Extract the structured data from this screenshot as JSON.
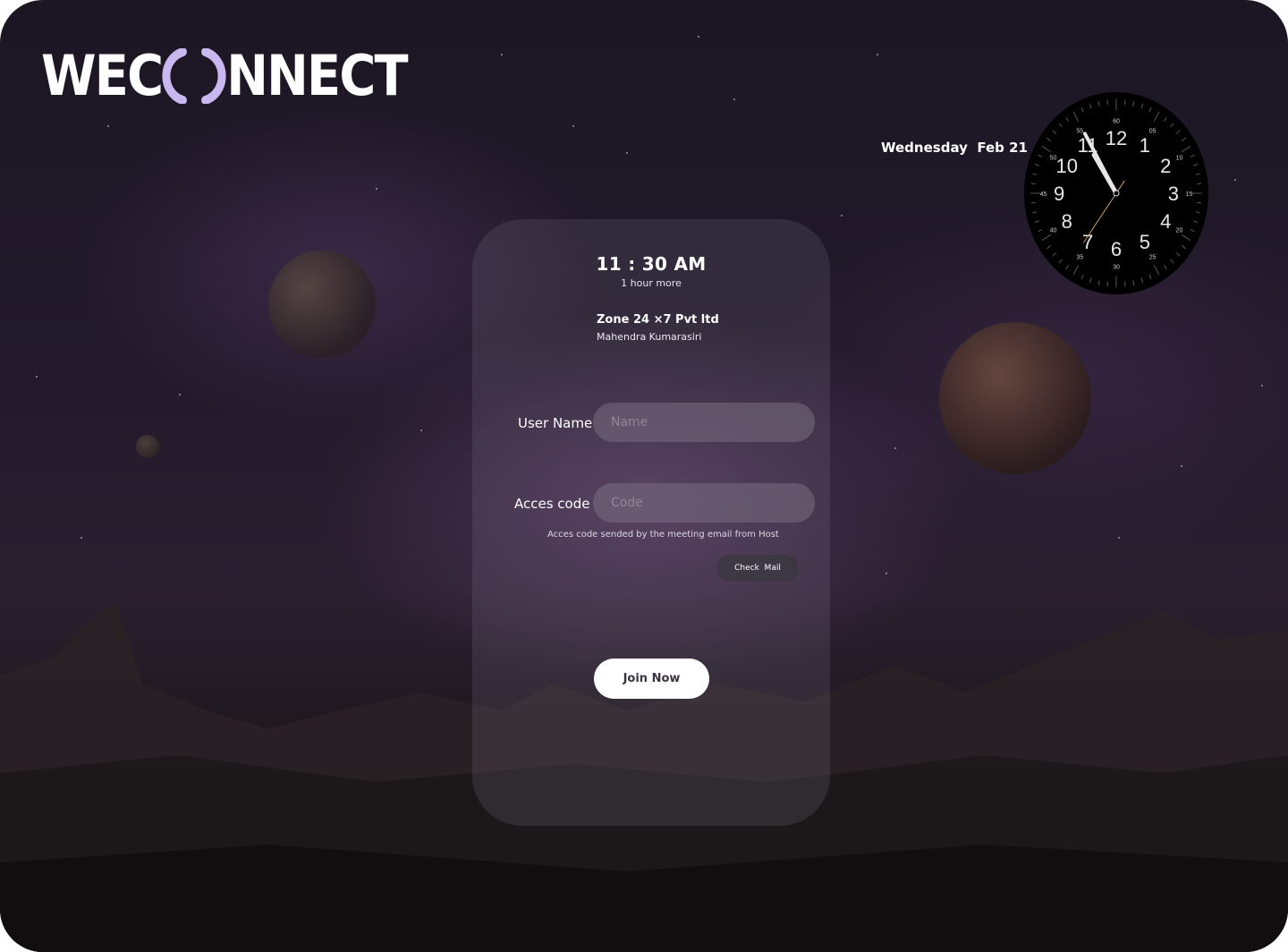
{
  "brand": {
    "logo_text_left": "WEC",
    "logo_text_right": "NNECT",
    "accent": "#c9b8f0"
  },
  "header": {
    "date_text": "Wednesday  Feb 21"
  },
  "clock": {
    "hour_numbers": [
      "12",
      "1",
      "2",
      "3",
      "4",
      "5",
      "6",
      "7",
      "8",
      "9",
      "10",
      "11"
    ],
    "minute_numbers": [
      "60",
      "05",
      "10",
      "15",
      "20",
      "25",
      "30",
      "35",
      "40",
      "45",
      "50",
      "55"
    ],
    "hands": {
      "hour": 10,
      "minute": 55,
      "second": 36
    }
  },
  "card": {
    "time": "11 : 30 AM",
    "time_note": "1 hour more",
    "org_name": "Zone 24 ×7 Pvt ltd",
    "host_name": "Mahendra Kumarasiri"
  },
  "form": {
    "username_label": "User Name",
    "username_placeholder": "Name",
    "username_value": "",
    "code_label": "Acces code",
    "code_placeholder": "Code",
    "code_value": "",
    "hint": "Acces code sended by the meeting email from Host",
    "check_mail_label": "Check  Mail",
    "join_label": "Join Now"
  },
  "background_text": {
    "zone": "Zone"
  }
}
